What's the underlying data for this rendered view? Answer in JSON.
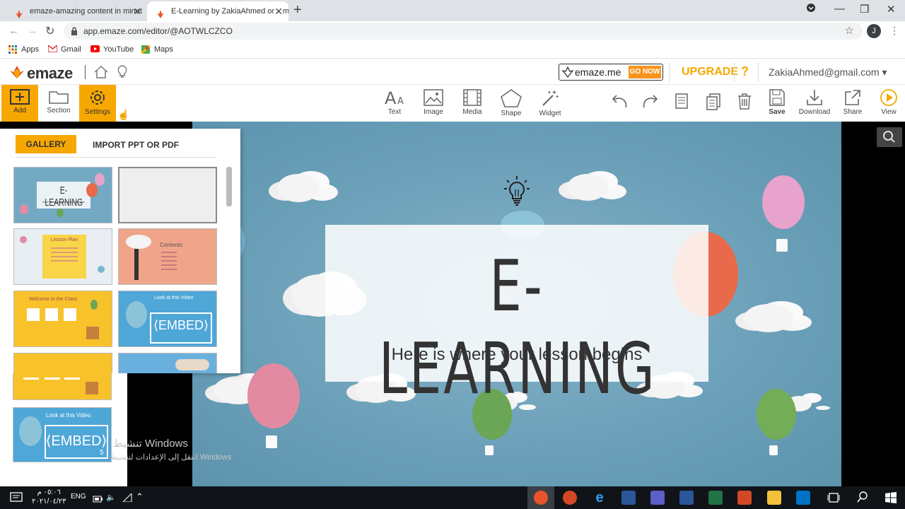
{
  "browser": {
    "tabs": [
      {
        "title": "emaze-amazing content in minut"
      },
      {
        "title": "E-Learning by ZakiaAhmed on em"
      }
    ],
    "url": "app.emaze.com/editor/@AOTWLCZCO",
    "profile_initial": "J",
    "bookmarks": [
      "Apps",
      "Gmail",
      "YouTube",
      "Maps"
    ]
  },
  "header": {
    "logo": "emaze",
    "emaze_me": "emaze.me",
    "go_now": "GO NOW",
    "upgrade": "UPGRADE",
    "help": "?",
    "account": "ZakiaAhmed@gmail.com ▾"
  },
  "toolbar": {
    "add": "Add",
    "section": "Section",
    "settings": "Settings",
    "text": "Text",
    "image": "Image",
    "media": "Media",
    "shape": "Shape",
    "widget": "Widget",
    "save": "Save",
    "download": "Download",
    "share": "Share",
    "view": "View"
  },
  "gallery": {
    "tab_gallery": "GALLERY",
    "tab_import": "IMPORT PPT OR PDF",
    "thumbs": [
      {
        "title": "E-LEARNING",
        "sub": "Here is where your lesson begins"
      },
      {
        "title": ""
      },
      {
        "title": "Lesson Plan"
      },
      {
        "title": "Contents"
      },
      {
        "title": "Welcome to the Class"
      },
      {
        "title": "Look at this Video",
        "embed": "⟨EMBED⟩"
      },
      {
        "title": ""
      },
      {
        "title": ""
      }
    ],
    "bottom_thumb": {
      "title": "Look at this Video",
      "embed": "⟨EMBED⟩",
      "num": "5"
    }
  },
  "slide": {
    "title": "E-LEARNING",
    "subtitle": "Here is where your lesson begins"
  },
  "watermark": {
    "line1": "تنشيط Windows",
    "line2": "انتقل إلى الإعدادات لتنشيط Windows"
  },
  "taskbar": {
    "lang": "ENG",
    "time": "٠٥:٠٦ م",
    "date": "٢٠٢١/٠٤/٢٣"
  }
}
